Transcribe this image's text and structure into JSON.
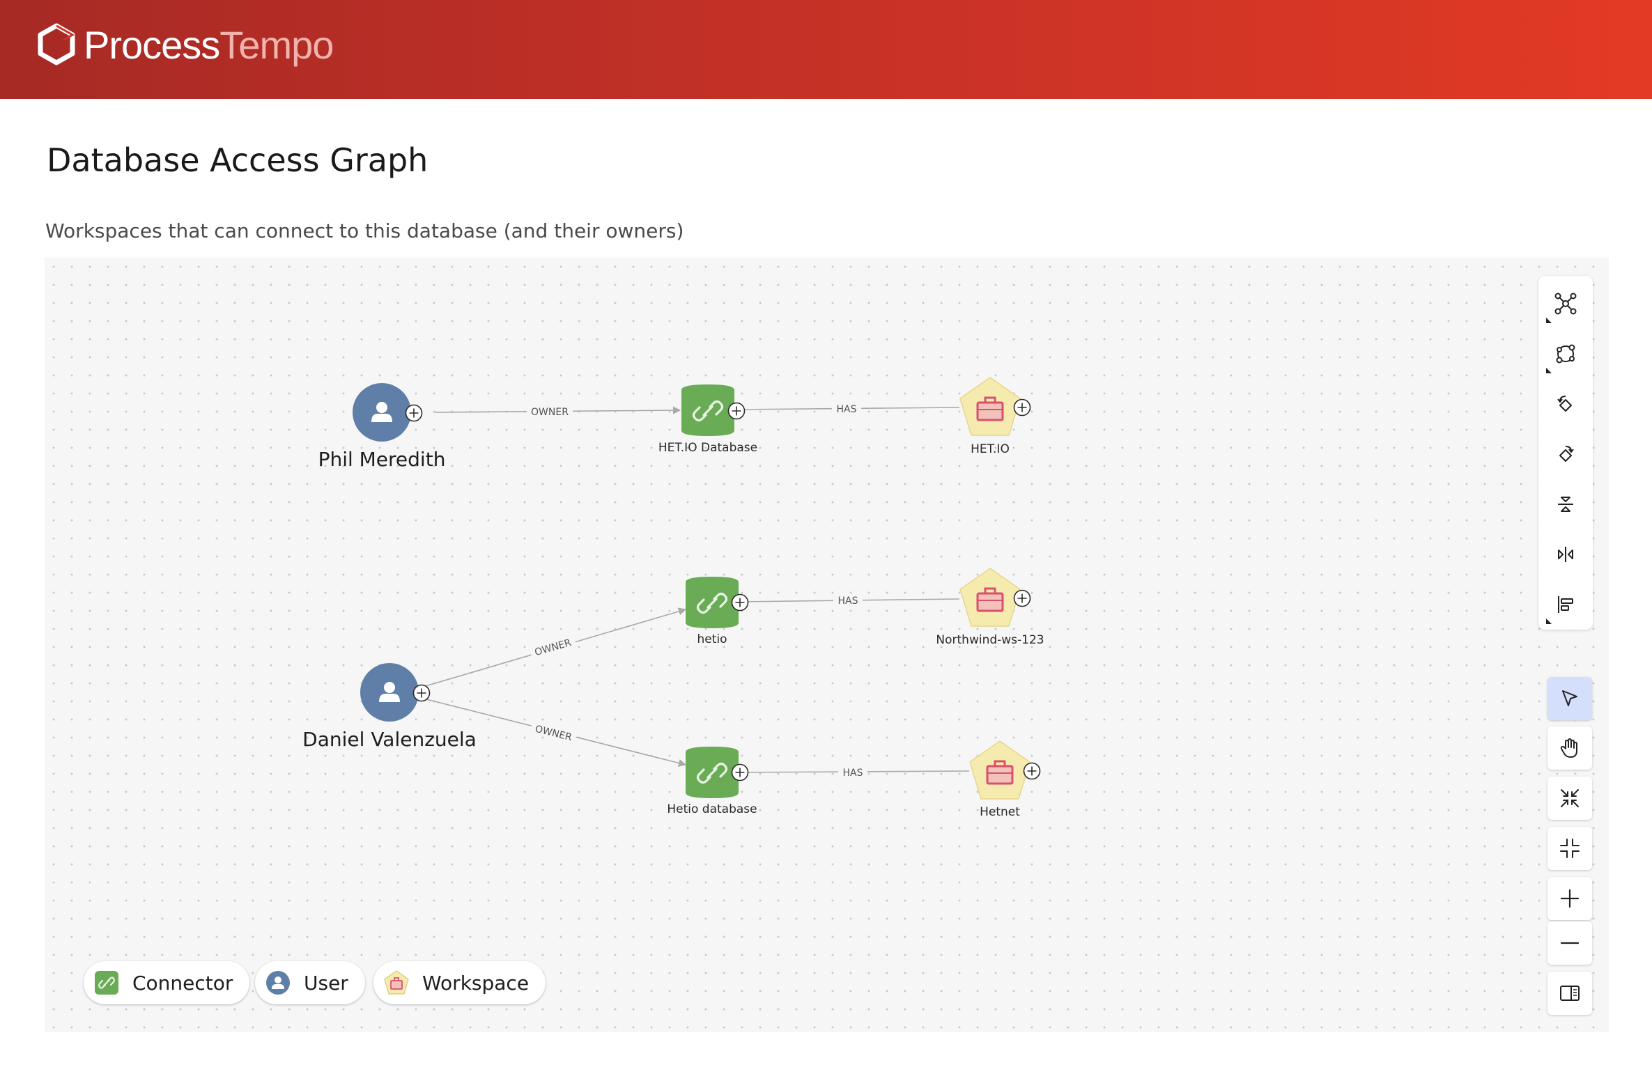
{
  "brand": {
    "name_part1": "Process",
    "name_part2": "Tempo"
  },
  "page": {
    "title": "Database Access Graph",
    "subtitle": "Workspaces that can connect to this database (and their owners)"
  },
  "graph": {
    "nodes": {
      "user_phil": {
        "label": "Phil Meredith",
        "type": "User"
      },
      "user_daniel": {
        "label": "Daniel Valenzuela",
        "type": "User"
      },
      "conn_hetio_db": {
        "label": "HET.IO Database",
        "type": "Connector"
      },
      "conn_hetio": {
        "label": "hetio",
        "type": "Connector"
      },
      "conn_hetio_database": {
        "label": "Hetio database",
        "type": "Connector"
      },
      "ws_hetio": {
        "label": "HET.IO",
        "type": "Workspace"
      },
      "ws_northwind": {
        "label": "Northwind-ws-123",
        "type": "Workspace"
      },
      "ws_hetnet": {
        "label": "Hetnet",
        "type": "Workspace"
      }
    },
    "edges": {
      "e1": {
        "from": "user_phil",
        "to": "conn_hetio_db",
        "label": "OWNER"
      },
      "e2": {
        "from": "conn_hetio_db",
        "to": "ws_hetio",
        "label": "HAS"
      },
      "e3": {
        "from": "user_daniel",
        "to": "conn_hetio",
        "label": "OWNER"
      },
      "e4": {
        "from": "conn_hetio",
        "to": "ws_northwind",
        "label": "HAS"
      },
      "e5": {
        "from": "user_daniel",
        "to": "conn_hetio_database",
        "label": "OWNER"
      },
      "e6": {
        "from": "conn_hetio_database",
        "to": "ws_hetnet",
        "label": "HAS"
      }
    }
  },
  "legend": {
    "connector": "Connector",
    "user": "User",
    "workspace": "Workspace"
  },
  "toolbar": {
    "tools": [
      "graph-layout-icon",
      "circular-layout-icon",
      "rotate-left-icon",
      "rotate-right-icon",
      "flip-vertical-icon",
      "flip-horizontal-icon",
      "align-left-icon"
    ],
    "controls": [
      "pointer-icon",
      "hand-pan-icon",
      "collapse-arrows-icon",
      "minimize-icon",
      "zoom-in-icon",
      "zoom-out-icon",
      "panel-toggle-icon"
    ],
    "active_control": "pointer-icon"
  },
  "colors": {
    "header_start": "#a72a25",
    "header_end": "#e23a25",
    "connector_green": "#6aab55",
    "user_blue": "#5f7fa8",
    "workspace_yellow": "#f6ebae",
    "workspace_briefcase": "#d8506e",
    "active_tool_bg": "#d4e0fb"
  }
}
